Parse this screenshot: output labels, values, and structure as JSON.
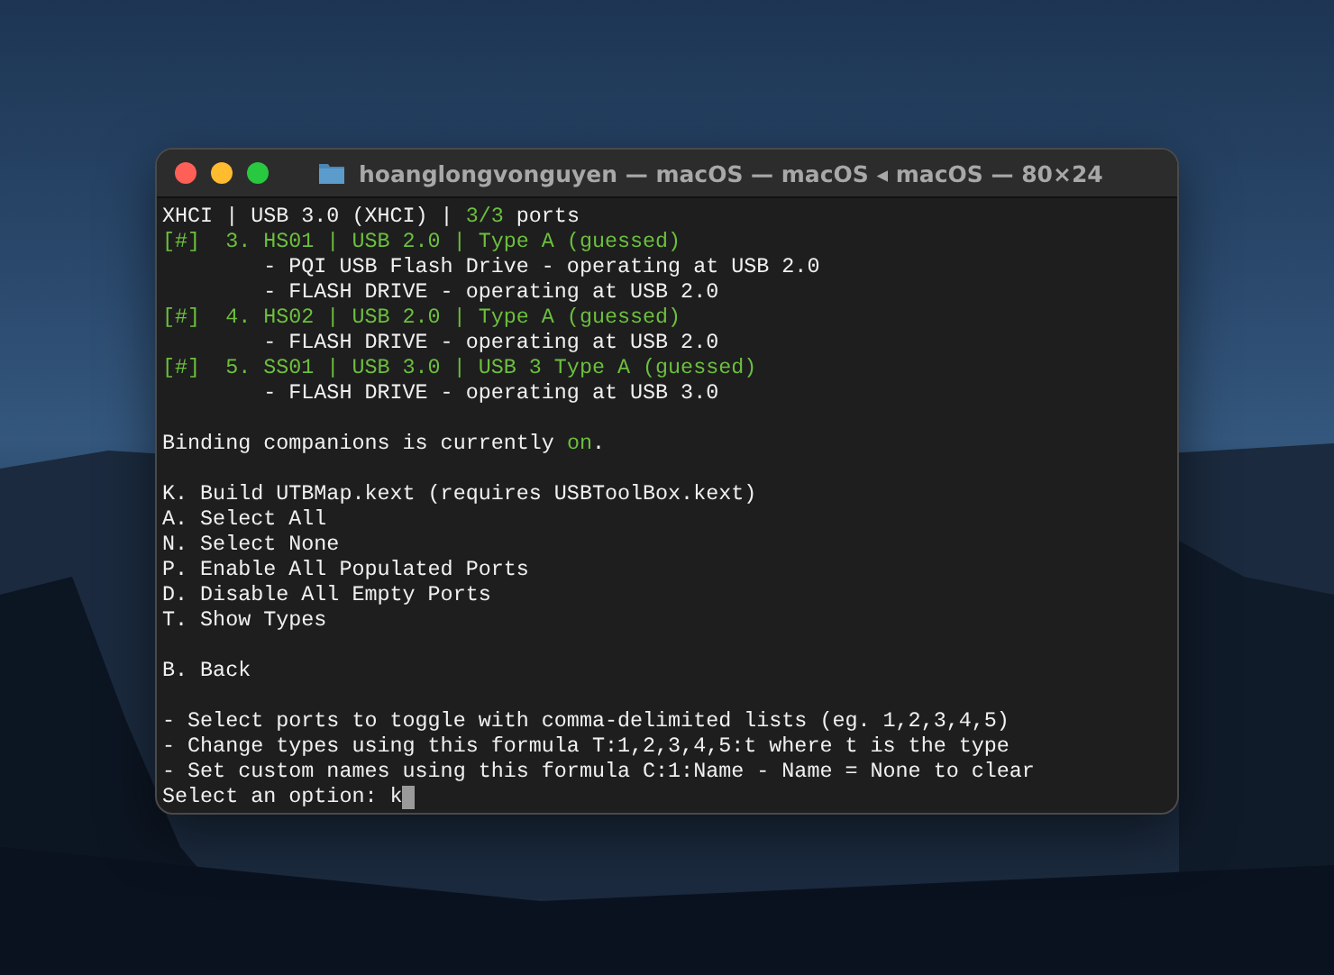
{
  "window": {
    "title": "hoanglongvonguyen — macOS — macOS ◂ macOS — 80×24"
  },
  "terminal": {
    "lines": [
      {
        "kind": "text",
        "segments": [
          {
            "text": "XHCI | USB 3.0 (XHCI) | ",
            "kind": "plain"
          },
          {
            "text": "3/3",
            "kind": "accent"
          },
          {
            "text": " ports",
            "kind": "plain"
          }
        ]
      },
      {
        "kind": "text",
        "segments": [
          {
            "text": "[#]  3. HS01 | USB 2.0 | Type A (guessed)",
            "kind": "accent"
          }
        ]
      },
      {
        "kind": "text",
        "segments": [
          {
            "text": "        - PQI USB Flash Drive - operating at USB 2.0",
            "kind": "plain"
          }
        ]
      },
      {
        "kind": "text",
        "segments": [
          {
            "text": "        - FLASH DRIVE - operating at USB 2.0",
            "kind": "plain"
          }
        ]
      },
      {
        "kind": "text",
        "segments": [
          {
            "text": "[#]  4. HS02 | USB 2.0 | Type A (guessed)",
            "kind": "accent"
          }
        ]
      },
      {
        "kind": "text",
        "segments": [
          {
            "text": "        - FLASH DRIVE - operating at USB 2.0",
            "kind": "plain"
          }
        ]
      },
      {
        "kind": "text",
        "segments": [
          {
            "text": "[#]  5. SS01 | USB 3.0 | USB 3 Type A (guessed)",
            "kind": "accent"
          }
        ]
      },
      {
        "kind": "text",
        "segments": [
          {
            "text": "        - FLASH DRIVE - operating at USB 3.0",
            "kind": "plain"
          }
        ]
      },
      {
        "kind": "blank"
      },
      {
        "kind": "text",
        "segments": [
          {
            "text": "Binding companions is currently ",
            "kind": "plain"
          },
          {
            "text": "on",
            "kind": "accent"
          },
          {
            "text": ".",
            "kind": "plain"
          }
        ]
      },
      {
        "kind": "blank"
      },
      {
        "kind": "text",
        "segments": [
          {
            "text": "K. Build UTBMap.kext (requires USBToolBox.kext)",
            "kind": "plain"
          }
        ]
      },
      {
        "kind": "text",
        "segments": [
          {
            "text": "A. Select All",
            "kind": "plain"
          }
        ]
      },
      {
        "kind": "text",
        "segments": [
          {
            "text": "N. Select None",
            "kind": "plain"
          }
        ]
      },
      {
        "kind": "text",
        "segments": [
          {
            "text": "P. Enable All Populated Ports",
            "kind": "plain"
          }
        ]
      },
      {
        "kind": "text",
        "segments": [
          {
            "text": "D. Disable All Empty Ports",
            "kind": "plain"
          }
        ]
      },
      {
        "kind": "text",
        "segments": [
          {
            "text": "T. Show Types",
            "kind": "plain"
          }
        ]
      },
      {
        "kind": "blank"
      },
      {
        "kind": "text",
        "segments": [
          {
            "text": "B. Back",
            "kind": "plain"
          }
        ]
      },
      {
        "kind": "blank"
      },
      {
        "kind": "text",
        "segments": [
          {
            "text": "- Select ports to toggle with comma-delimited lists (eg. 1,2,3,4,5)",
            "kind": "plain"
          }
        ]
      },
      {
        "kind": "text",
        "segments": [
          {
            "text": "- Change types using this formula T:1,2,3,4,5:t where t is the type",
            "kind": "plain"
          }
        ]
      },
      {
        "kind": "text",
        "segments": [
          {
            "text": "- Set custom names using this formula C:1:Name - Name = None to clear",
            "kind": "plain"
          }
        ]
      }
    ],
    "prompt": {
      "text": "Select an option: k"
    }
  }
}
